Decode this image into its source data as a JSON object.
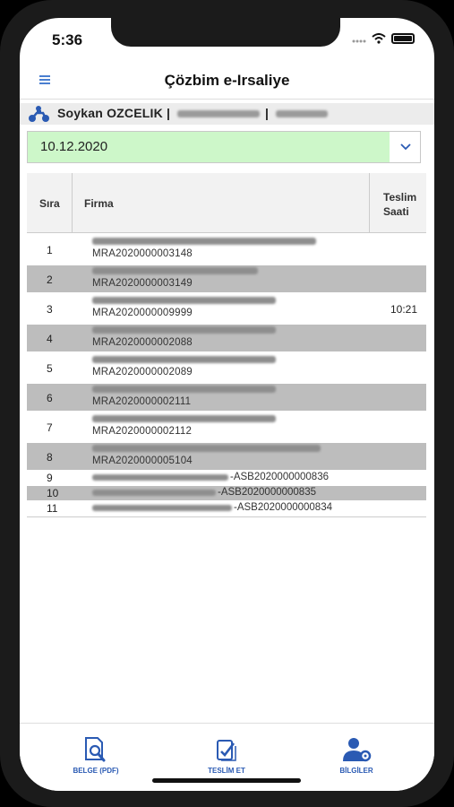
{
  "status": {
    "time": "5:36"
  },
  "header": {
    "title": "Çözbim e-Irsaliye",
    "menu_icon": "hamburger-menu-icon"
  },
  "user": {
    "icon": "courier-motorbike-icon",
    "name": "Soykan OZCELIK |",
    "separator": "|"
  },
  "date_select": {
    "value": "10.12.2020",
    "icon": "chevron-down-icon"
  },
  "table": {
    "headers": {
      "sira": "Sıra",
      "firma": "Firma",
      "teslim_1": "Teslim",
      "teslim_2": "Saati"
    },
    "rows": [
      {
        "sira": "1",
        "code": "MRA2020000003148",
        "time": ""
      },
      {
        "sira": "2",
        "code": "MRA2020000003149",
        "time": ""
      },
      {
        "sira": "3",
        "code": "MRA2020000009999",
        "time": "10:21"
      },
      {
        "sira": "4",
        "code": "MRA2020000002088",
        "time": ""
      },
      {
        "sira": "5",
        "code": "MRA2020000002089",
        "time": ""
      },
      {
        "sira": "6",
        "code": "MRA2020000002111",
        "time": ""
      },
      {
        "sira": "7",
        "code": "MRA2020000002112",
        "time": ""
      },
      {
        "sira": "8",
        "code": "MRA2020000005104",
        "time": ""
      },
      {
        "sira": "9",
        "code": "-ASB2020000000836",
        "time": ""
      },
      {
        "sira": "10",
        "code": "-ASB2020000000835",
        "time": ""
      },
      {
        "sira": "11",
        "code": "-ASB2020000000834",
        "time": ""
      }
    ]
  },
  "tabs": [
    {
      "label": "BELGE (PDF)",
      "icon": "document-search-icon"
    },
    {
      "label": "TESLİM ET",
      "icon": "deliver-check-icon"
    },
    {
      "label": "BİLGİLER",
      "icon": "user-settings-icon"
    }
  ],
  "colors": {
    "accent": "#2a5ab3",
    "date_bg": "#cdf7c9",
    "row_gray": "#bdbdbd"
  }
}
